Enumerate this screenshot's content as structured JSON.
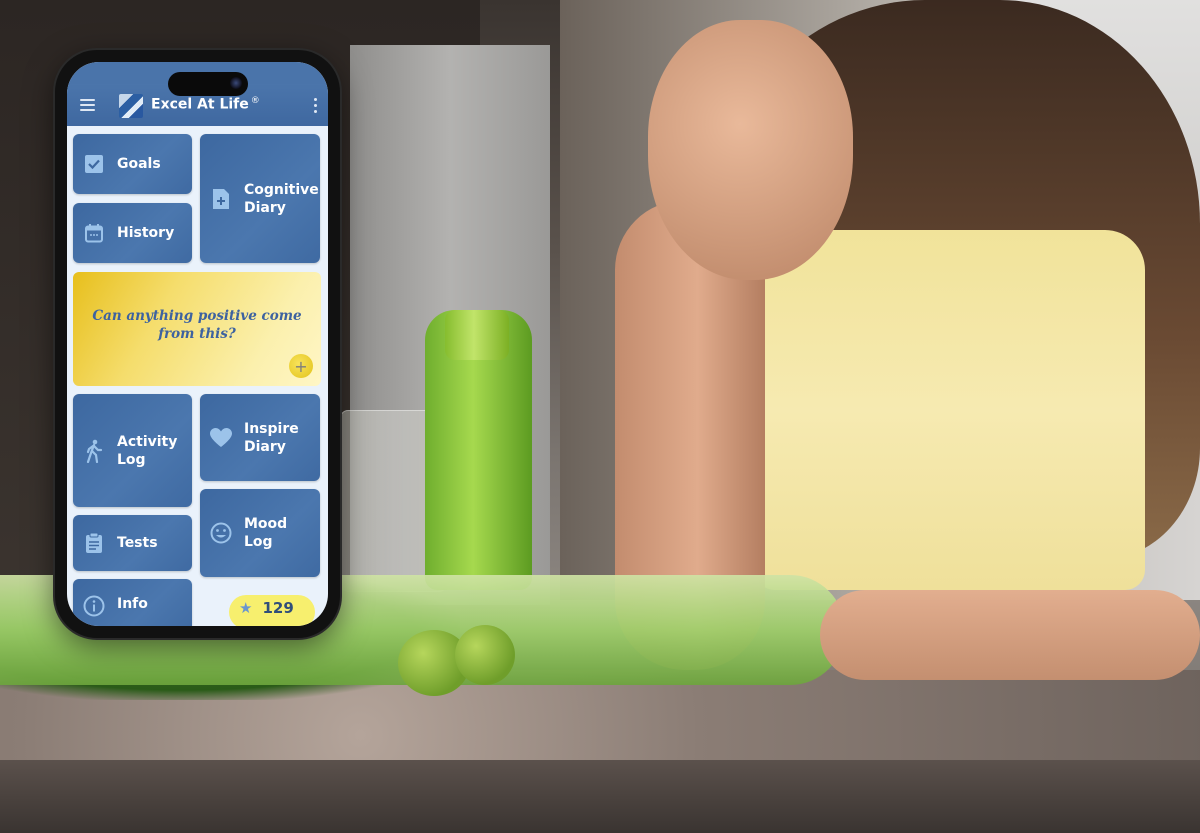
{
  "app": {
    "title": "Excel At Life",
    "registered_mark": "®"
  },
  "appbar": {
    "menu_icon": "hamburger-menu-icon",
    "overflow_icon": "more-vertical-icon"
  },
  "tiles": [
    {
      "id": "goals",
      "label": "Goals",
      "icon": "checkbox-icon",
      "glyph": "☑"
    },
    {
      "id": "history",
      "label": "History",
      "icon": "calendar-icon",
      "glyph": "▦"
    },
    {
      "id": "cognitive-diary",
      "label_line1": "Cognitive",
      "label_line2": "Diary",
      "icon": "document-add-icon",
      "glyph": "🗎"
    },
    {
      "id": "activity-log",
      "label_line1": "Activity",
      "label_line2": "Log",
      "icon": "walking-person-icon",
      "glyph": "🚶"
    },
    {
      "id": "inspire-diary",
      "label_line1": "Inspire",
      "label_line2": "Diary",
      "icon": "heart-icon",
      "glyph": "♥"
    },
    {
      "id": "tests",
      "label": "Tests",
      "icon": "clipboard-icon",
      "glyph": "📋"
    },
    {
      "id": "mood-log",
      "label": "Mood Log",
      "icon": "smiley-icon",
      "glyph": "☺"
    },
    {
      "id": "info",
      "label": "Info",
      "icon": "info-icon",
      "glyph": "ⓘ"
    }
  ],
  "quote_card": {
    "text": "Can anything positive come from this?",
    "add_glyph": "+"
  },
  "points_badge": {
    "star_glyph": "★",
    "value": "129"
  },
  "colors": {
    "appbar": "#4270a6",
    "tile": "#4571a8",
    "screen_bg": "#eaf2fb",
    "quote_gold": "#e7bf1c",
    "quote_text": "#3d62a0",
    "badge": "#f7ef6e"
  }
}
